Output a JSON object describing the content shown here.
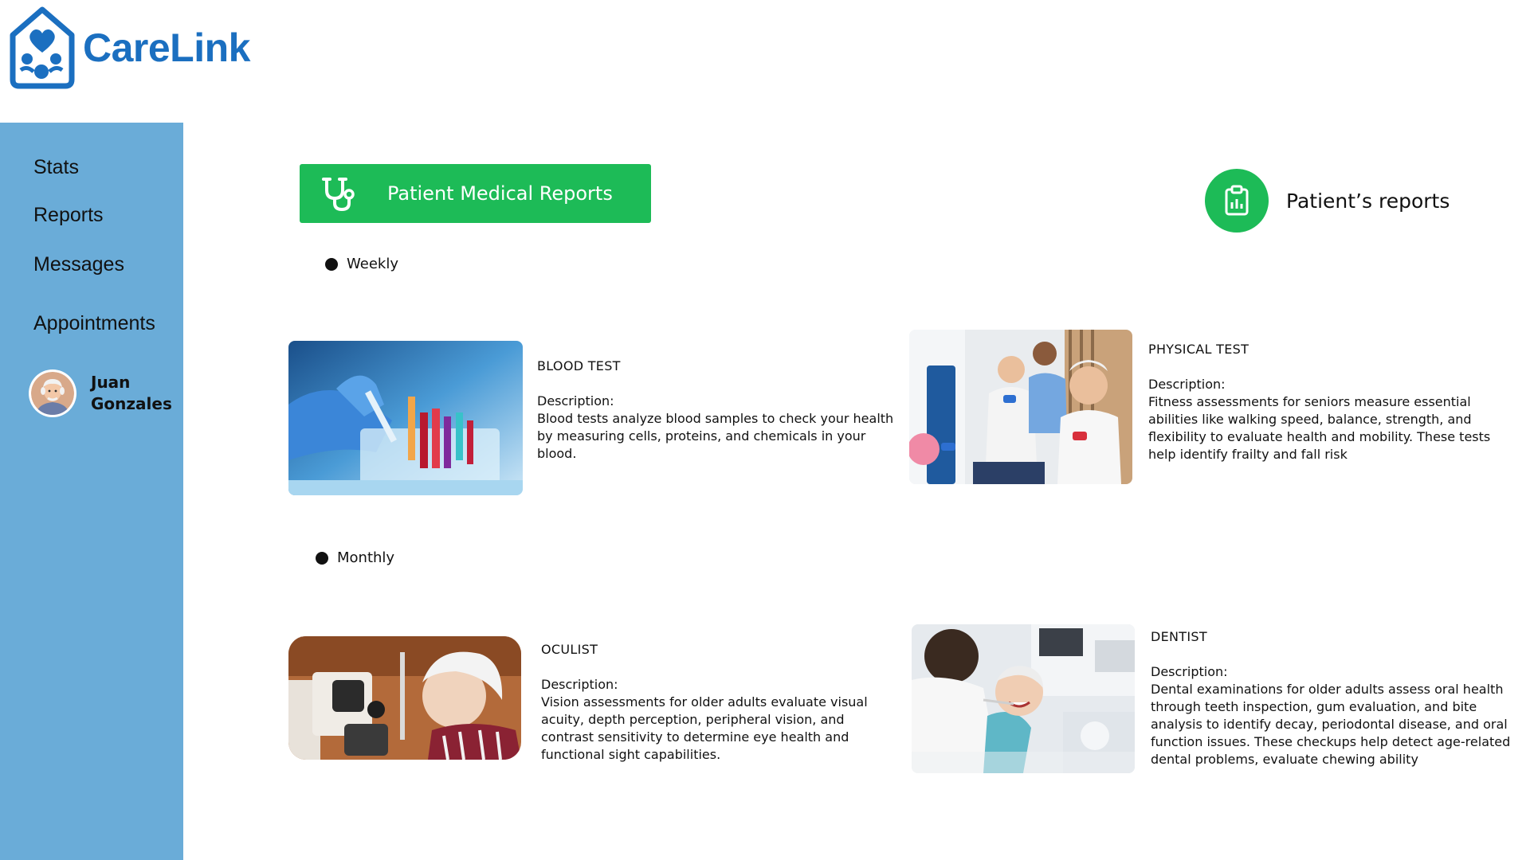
{
  "brand": {
    "name": "CareLink",
    "color": "#1b6fc0"
  },
  "sidebar": {
    "background": "#6aacd8",
    "items": [
      {
        "label": "Stats"
      },
      {
        "label": "Reports"
      },
      {
        "label": "Messages"
      },
      {
        "label": "Appointments"
      }
    ],
    "user": {
      "first_name": "Juan",
      "last_name": "Gonzales"
    }
  },
  "header": {
    "button_label": "Patient Medical Reports",
    "button_icon": "stethoscope-icon",
    "accent": "#1dbb57",
    "patients_reports_label": "Patient’s reports",
    "patients_reports_icon": "clipboard-chart-icon"
  },
  "sections": [
    {
      "label": "Weekly",
      "cards": [
        {
          "title": "BLOOD TEST",
          "description_label": "Description:",
          "description": "Blood tests analyze blood samples to check your health by measuring cells, proteins, and chemicals in your blood.",
          "image": "blood-test-tubes-image"
        },
        {
          "title": "PHYSICAL TEST",
          "description_label": "Description:",
          "description": "Fitness assessments for seniors measure essential abilities like walking speed, balance, strength, and flexibility to evaluate health and mobility. These tests help identify frailty and fall risk",
          "image": "seniors-exercising-image"
        }
      ]
    },
    {
      "label": "Monthly",
      "cards": [
        {
          "title": "OCULIST",
          "description_label": "Description:",
          "description": "Vision assessments for older adults evaluate visual acuity, depth perception, peripheral vision, and contrast sensitivity to determine eye health and functional sight capabilities.",
          "image": "eye-exam-image"
        },
        {
          "title": "DENTIST",
          "description_label": "Description:",
          "description": "Dental examinations for older adults assess oral health through teeth inspection, gum evaluation, and bite analysis to identify decay, periodontal disease, and oral function issues. These checkups help detect age-related dental problems, evaluate chewing ability",
          "image": "dental-exam-image"
        }
      ]
    }
  ]
}
